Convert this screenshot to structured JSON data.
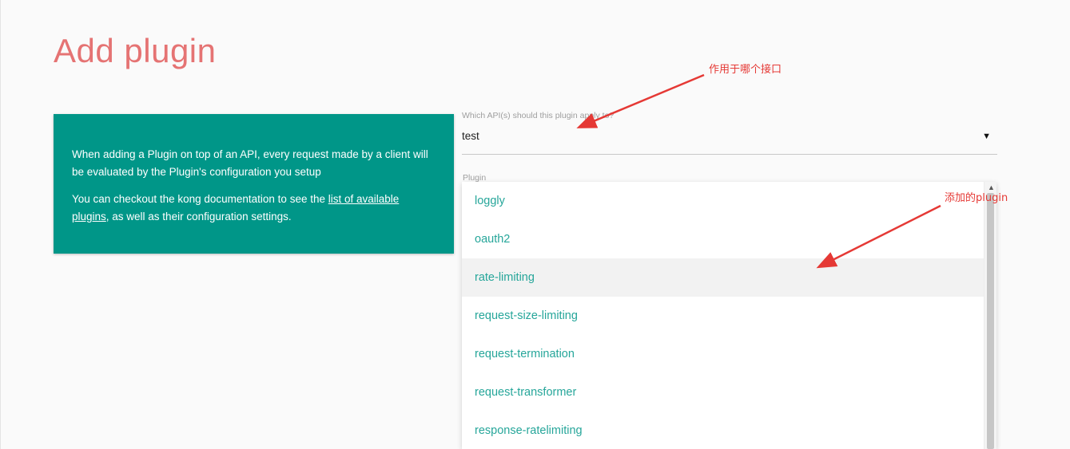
{
  "page": {
    "title": "Add plugin"
  },
  "info": {
    "line1": "When adding a Plugin on top of an API, every request made by a client will be evaluated by the Plugin's configuration you setup",
    "line2_prefix": "You can checkout the kong documentation to see the ",
    "link_text": "list of available plugins",
    "line2_suffix": ", as well as their configuration settings."
  },
  "api_field": {
    "label": "Which API(s) should this plugin apply to?",
    "value": "test",
    "caret": "▼"
  },
  "plugin_field": {
    "label": "Plugin",
    "options": [
      "loggly",
      "oauth2",
      "rate-limiting",
      "request-size-limiting",
      "request-termination",
      "request-transformer",
      "response-ratelimiting"
    ],
    "hovered": "rate-limiting"
  },
  "annotations": {
    "api_note": "作用于哪个接口",
    "plugin_note": "添加的plugin",
    "color": "#e53935"
  },
  "colors": {
    "title": "#e57373",
    "card": "#009688",
    "option_text": "#26a69a"
  }
}
